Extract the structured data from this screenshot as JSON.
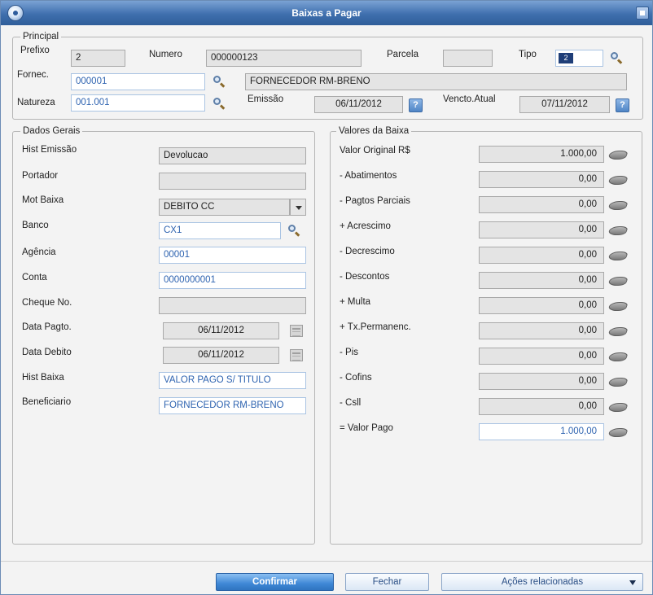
{
  "window": {
    "title": "Baixas a Pagar"
  },
  "principal": {
    "legend": "Principal",
    "prefixo": {
      "label": "Prefixo",
      "value": "2"
    },
    "numero": {
      "label": "Numero",
      "value": "000000123"
    },
    "parcela": {
      "label": "Parcela",
      "value": ""
    },
    "tipo": {
      "label": "Tipo",
      "value": "2"
    },
    "fornec": {
      "label": "Fornec.",
      "value": "000001",
      "name": "FORNECEDOR RM-BRENO"
    },
    "natureza": {
      "label": "Natureza",
      "value": "001.001"
    },
    "emissao": {
      "label": "Emissão",
      "value": "06/11/2012"
    },
    "vencto": {
      "label": "Vencto.Atual",
      "value": "07/11/2012"
    }
  },
  "dados_gerais": {
    "legend": "Dados Gerais",
    "rows": [
      {
        "label": "Hist Emissão",
        "value": "Devolucao"
      },
      {
        "label": "Portador",
        "value": ""
      },
      {
        "label": "Mot Baixa",
        "value": "DEBITO CC"
      },
      {
        "label": "Banco",
        "value": "CX1"
      },
      {
        "label": "Agência",
        "value": "00001"
      },
      {
        "label": "Conta",
        "value": "0000000001"
      },
      {
        "label": "Cheque No.",
        "value": ""
      },
      {
        "label": "Data Pagto.",
        "value": "06/11/2012"
      },
      {
        "label": "Data Debito",
        "value": "06/11/2012"
      },
      {
        "label": "Hist Baixa",
        "value": "VALOR PAGO S/ TITULO"
      },
      {
        "label": "Beneficiario",
        "value": "FORNECEDOR RM-BRENO"
      }
    ]
  },
  "valores": {
    "legend": "Valores da Baixa",
    "rows": [
      {
        "label": "Valor Original R$",
        "value": "1.000,00"
      },
      {
        "label": "- Abatimentos",
        "value": "0,00"
      },
      {
        "label": "- Pagtos Parciais",
        "value": "0,00"
      },
      {
        "label": "+ Acrescimo",
        "value": "0,00"
      },
      {
        "label": "- Decrescimo",
        "value": "0,00"
      },
      {
        "label": "- Descontos",
        "value": "0,00"
      },
      {
        "label": "+ Multa",
        "value": "0,00"
      },
      {
        "label": "+ Tx.Permanenc.",
        "value": "0,00"
      },
      {
        "label": "- Pis",
        "value": "0,00"
      },
      {
        "label": "- Cofins",
        "value": "0,00"
      },
      {
        "label": "- Csll",
        "value": "0,00"
      },
      {
        "label": "= Valor Pago",
        "value": "1.000,00"
      }
    ]
  },
  "buttons": {
    "confirmar": "Confirmar",
    "fechar": "Fechar",
    "acoes": "Ações relacionadas"
  },
  "icons": {
    "app": "app-icon",
    "close": "close-icon",
    "lookup": "search-icon",
    "help": "help-icon",
    "calendar": "calendar-icon",
    "dropdown": "chevron-down-icon",
    "calc": "calculator-icon"
  },
  "colors": {
    "titlebar": "#3f6fae",
    "primary_button": "#3f88d6",
    "editable_text": "#2e63b0"
  }
}
